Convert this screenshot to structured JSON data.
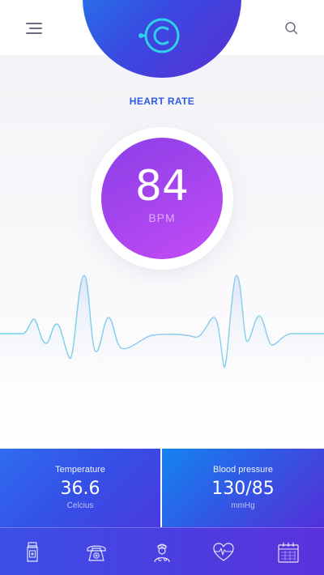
{
  "header": {
    "menu_icon": "menu-icon",
    "logo_icon": "logo-icon",
    "search_icon": "search-icon"
  },
  "heart_rate": {
    "title": "HEART RATE",
    "value": "84",
    "unit": "BPM"
  },
  "stats": {
    "temperature": {
      "label": "Temperature",
      "value": "36.6",
      "unit": "Celcius"
    },
    "blood_pressure": {
      "label": "Blood pressure",
      "value": "130/85",
      "unit": "mmHg"
    }
  },
  "nav": {
    "items": [
      {
        "icon": "medicine-bottle-icon"
      },
      {
        "icon": "phone-icon"
      },
      {
        "icon": "doctor-icon"
      },
      {
        "icon": "heartbeat-icon"
      },
      {
        "icon": "calendar-icon"
      }
    ]
  },
  "colors": {
    "accent": "#2d5be3",
    "bpm_gradient_start": "#8b3fe6",
    "bpm_gradient_end": "#c54cf6",
    "card_blue": "#1384ef",
    "card_purple": "#5430d8",
    "ecg_line": "#7fd3e8"
  }
}
